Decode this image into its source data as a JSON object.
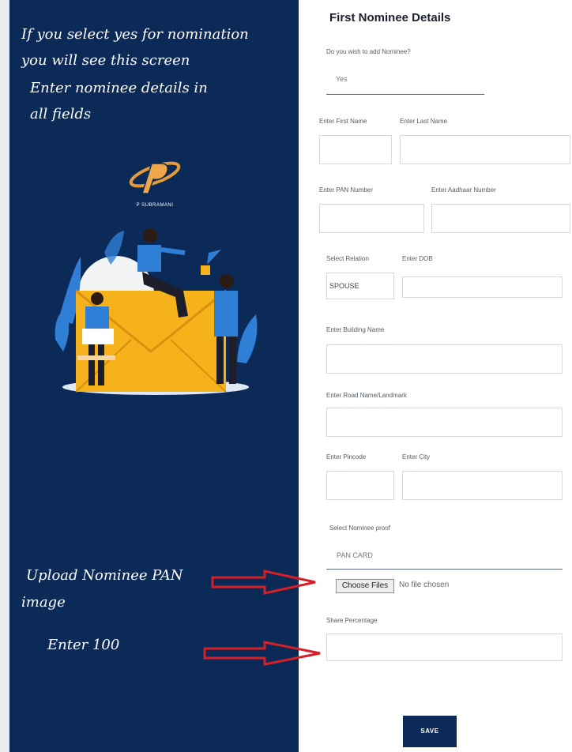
{
  "annotations": {
    "line1": "If you select yes for nomination",
    "line2": "you will see this screen",
    "line3": "Enter nominee details in",
    "line4": "all fields",
    "upload1": "Upload Nominee PAN",
    "upload2": "image",
    "enter100": "Enter 100"
  },
  "logo": {
    "text": "P SUBRAMANI"
  },
  "form": {
    "title": "First Nominee Details",
    "add_nominee_label": "Do you wish to add Nominee?",
    "add_nominee_value": "Yes",
    "first_name_label": "Enter First Name",
    "last_name_label": "Enter Last Name",
    "pan_label": "Enter PAN Number",
    "aadhaar_label": "Enter Aadhaar Number",
    "relation_label": "Select Relation",
    "relation_value": "SPOUSE",
    "dob_label": "Enter DOB",
    "building_label": "Enter Building Name",
    "road_label": "Enter Road Name/Landmark",
    "pincode_label": "Enter Pincode",
    "city_label": "Enter City",
    "proof_label": "Select Nominee proof",
    "proof_value": "PAN CARD",
    "choose_files": "Choose Files",
    "no_file": "No file chosen",
    "share_label": "Share Percentage",
    "save": "SAVE"
  },
  "colors": {
    "panel": "#0b2a57",
    "arrow": "#d61f26",
    "illustration_blue": "#2f7fd6",
    "envelope": "#f5b21b"
  }
}
